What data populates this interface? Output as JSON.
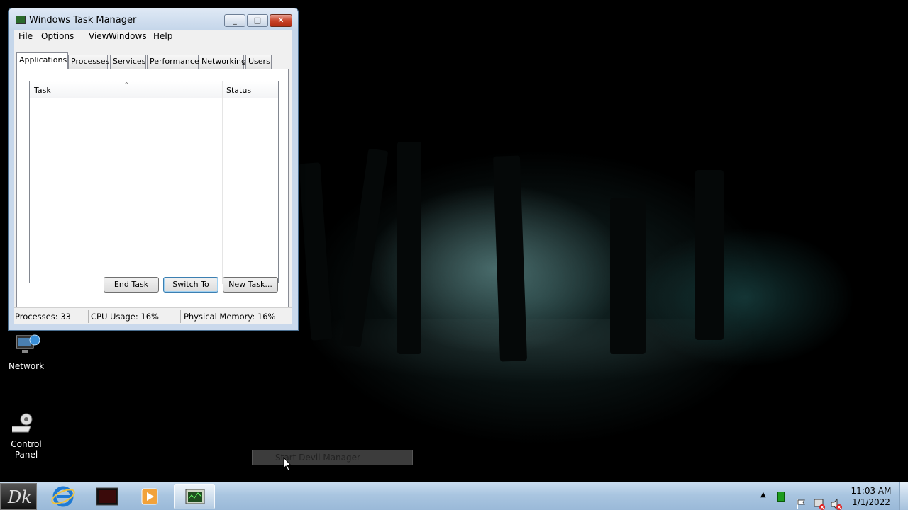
{
  "window": {
    "title": "Windows Task Manager",
    "minimize_glyph": "_",
    "maximize_glyph": "□",
    "close_glyph": "✕"
  },
  "menu": [
    "File",
    "Options",
    "View",
    "Windows",
    "Help"
  ],
  "tabs": [
    "Applications",
    "Processes",
    "Services",
    "Performance",
    "Networking",
    "Users"
  ],
  "active_tab": "Applications",
  "listview": {
    "columns": [
      "Task",
      "Status"
    ],
    "rows": []
  },
  "buttons": {
    "end_task": "End Task",
    "switch_to": "Switch To",
    "new_task": "New Task..."
  },
  "status": {
    "processes": "Processes: 33",
    "cpu": "CPU Usage: 16%",
    "memory": "Physical Memory: 16%"
  },
  "desktop_icons": [
    {
      "label": "Network",
      "icon": "network-icon"
    },
    {
      "label": "Control Panel",
      "icon": "control-panel-icon"
    }
  ],
  "popup": {
    "label": "Start Devil Manager"
  },
  "taskbar": {
    "start_label": "Dk",
    "pinned": [
      "internet-explorer-icon",
      "folder-icon",
      "media-player-icon",
      "task-manager-icon"
    ]
  },
  "clock": {
    "time": "11:03 AM",
    "date": "1/1/2022"
  },
  "colors": {
    "accent": "#3c7fb1",
    "close": "#c8442a"
  }
}
